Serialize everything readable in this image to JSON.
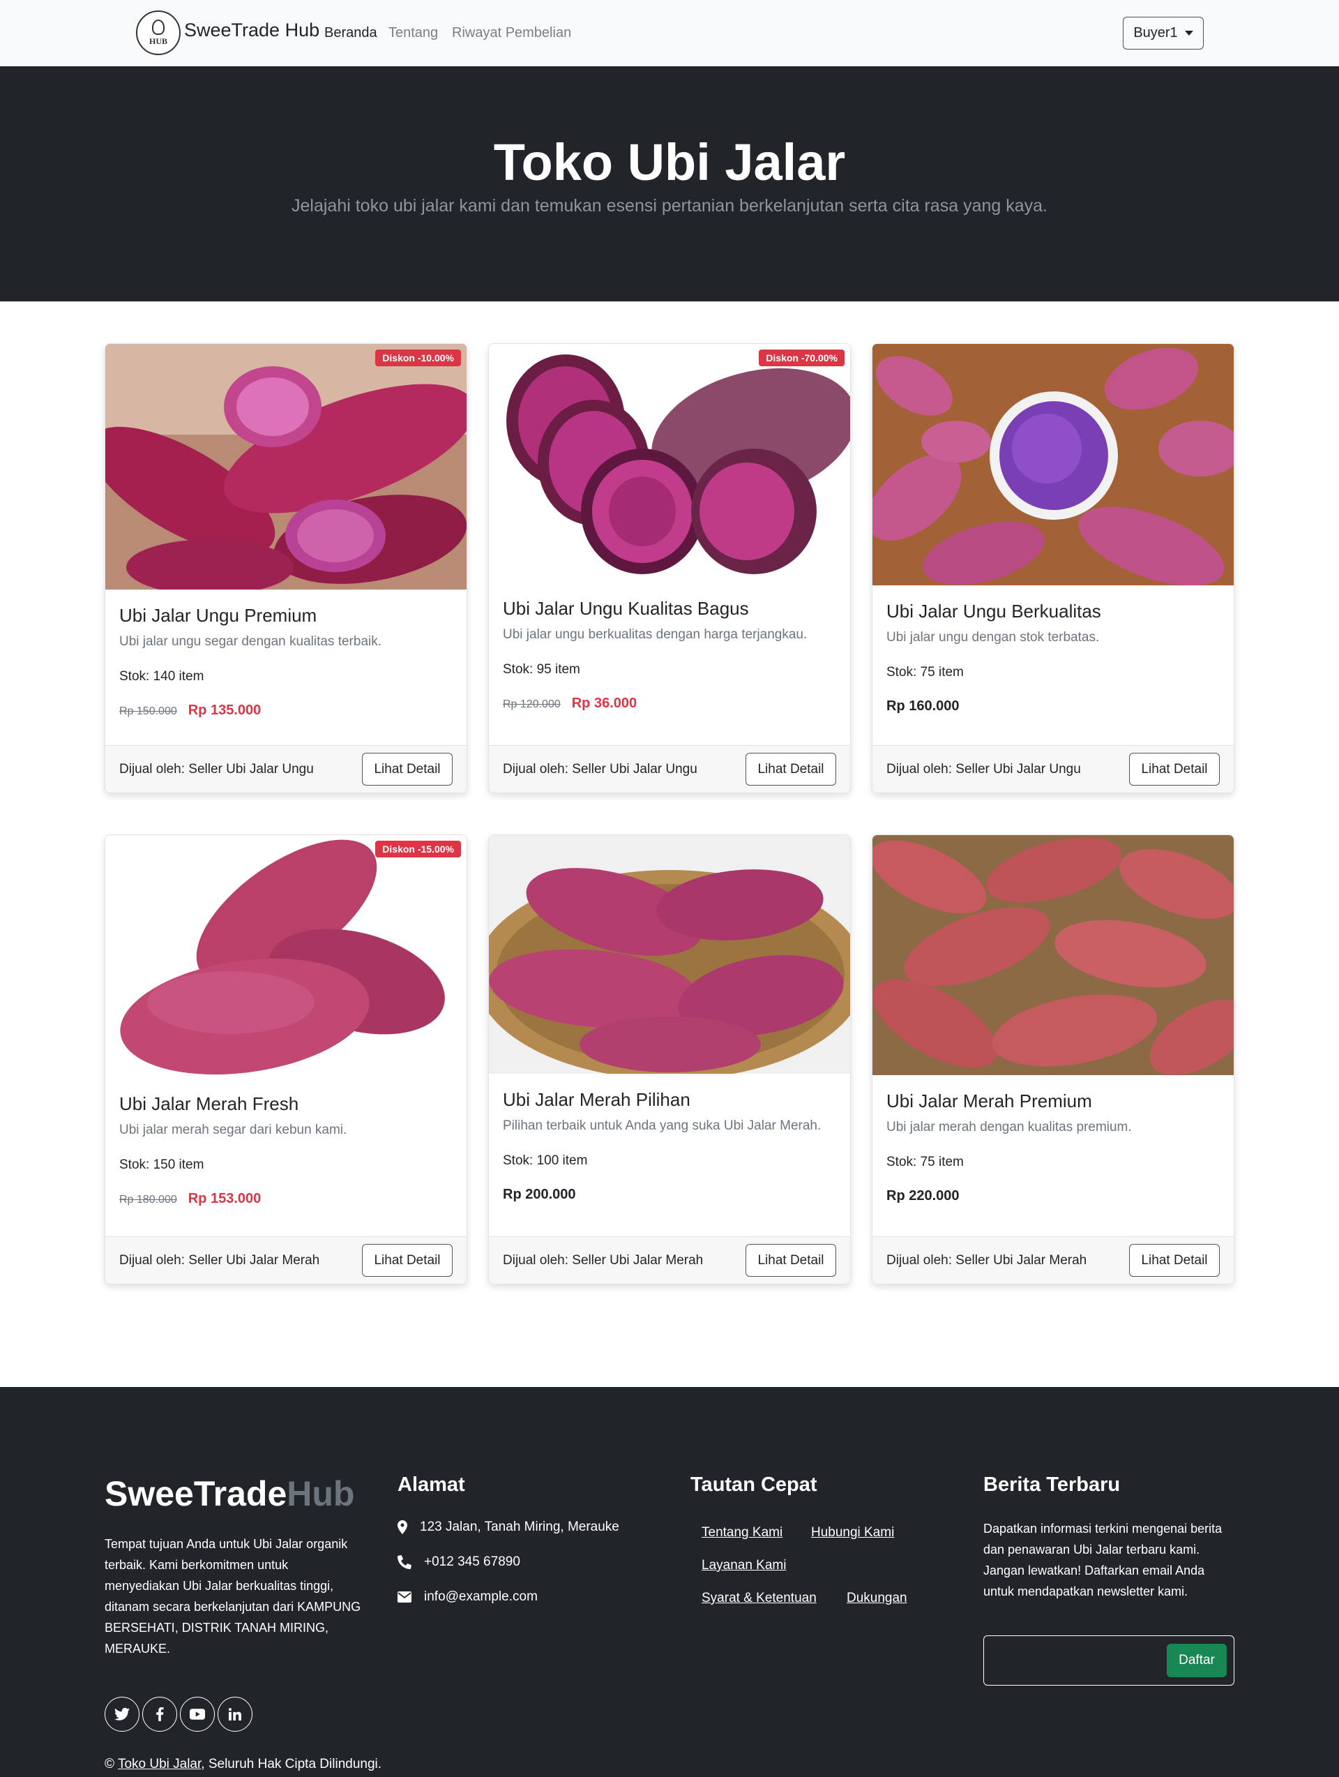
{
  "nav": {
    "logo_text": "HUB",
    "brand": "SweeTrade Hub",
    "links": [
      "Beranda",
      "Tentang",
      "Riwayat Pembelian"
    ],
    "user": "Buyer1"
  },
  "hero": {
    "title": "Toko Ubi Jalar",
    "subtitle": "Jelajahi toko ubi jalar kami dan temukan esensi pertanian berkelanjutan serta cita rasa yang kaya."
  },
  "products": [
    {
      "badge": "Diskon -10.00%",
      "title": "Ubi Jalar Ungu Premium",
      "desc": "Ubi jalar ungu segar dengan kualitas terbaik.",
      "stock": "Stok: 140 item",
      "old_price": "Rp 150.000",
      "price": "Rp 135.000",
      "seller": "Dijual oleh: Seller Ubi Jalar Ungu",
      "button": "Lihat Detail"
    },
    {
      "badge": "Diskon -70.00%",
      "title": "Ubi Jalar Ungu Kualitas Bagus",
      "desc": "Ubi jalar ungu berkualitas dengan harga terjangkau.",
      "stock": "Stok: 95 item",
      "old_price": "Rp 120.000",
      "price": "Rp 36.000",
      "seller": "Dijual oleh: Seller Ubi Jalar Ungu",
      "button": "Lihat Detail"
    },
    {
      "badge": "",
      "title": "Ubi Jalar Ungu Berkualitas",
      "desc": "Ubi jalar ungu dengan stok terbatas.",
      "stock": "Stok: 75 item",
      "old_price": "",
      "price": "Rp 160.000",
      "seller": "Dijual oleh: Seller Ubi Jalar Ungu",
      "button": "Lihat Detail"
    },
    {
      "badge": "Diskon -15.00%",
      "title": "Ubi Jalar Merah Fresh",
      "desc": "Ubi jalar merah segar dari kebun kami.",
      "stock": "Stok: 150 item",
      "old_price": "Rp 180.000",
      "price": "Rp 153.000",
      "seller": "Dijual oleh: Seller Ubi Jalar Merah",
      "button": "Lihat Detail"
    },
    {
      "badge": "",
      "title": "Ubi Jalar Merah Pilihan",
      "desc": "Pilihan terbaik untuk Anda yang suka Ubi Jalar Merah.",
      "stock": "Stok: 100 item",
      "old_price": "",
      "price": "Rp 200.000",
      "seller": "Dijual oleh: Seller Ubi Jalar Merah",
      "button": "Lihat Detail"
    },
    {
      "badge": "",
      "title": "Ubi Jalar Merah Premium",
      "desc": "Ubi jalar merah dengan kualitas premium.",
      "stock": "Stok: 75 item",
      "old_price": "",
      "price": "Rp 220.000",
      "seller": "Dijual oleh: Seller Ubi Jalar Merah",
      "button": "Lihat Detail"
    }
  ],
  "footer": {
    "brand_a": "SweeTrade",
    "brand_b": "Hub",
    "about": "Tempat tujuan Anda untuk Ubi Jalar organik terbaik. Kami berkomitmen untuk menyediakan Ubi Jalar berkualitas tinggi, ditanam secara berkelanjutan dari KAMPUNG BERSEHATI, DISTRIK TANAH MIRING, MERAUKE.",
    "socials": [
      "twitter-icon",
      "facebook-icon",
      "youtube-icon",
      "linkedin-icon"
    ],
    "address_title": "Alamat",
    "address": "123 Jalan, Tanah Miring, Merauke",
    "phone": "+012 345 67890",
    "email": "info@example.com",
    "links_title": "Tautan Cepat",
    "links": [
      "Tentang Kami",
      "Hubungi Kami",
      "Layanan Kami",
      "Syarat & Ketentuan",
      "Dukungan"
    ],
    "news_title": "Berita Terbaru",
    "news_text": "Dapatkan informasi terkini mengenai berita dan penawaran Ubi Jalar terbaru kami. Jangan lewatkan! Daftarkan email Anda untuk mendapatkan newsletter kami.",
    "subscribe": "Daftar",
    "copyright_prefix": "©",
    "copyright_link": "Toko Ubi Jalar",
    "copyright_suffix": ", Seluruh Hak Cipta Dilindungi."
  }
}
